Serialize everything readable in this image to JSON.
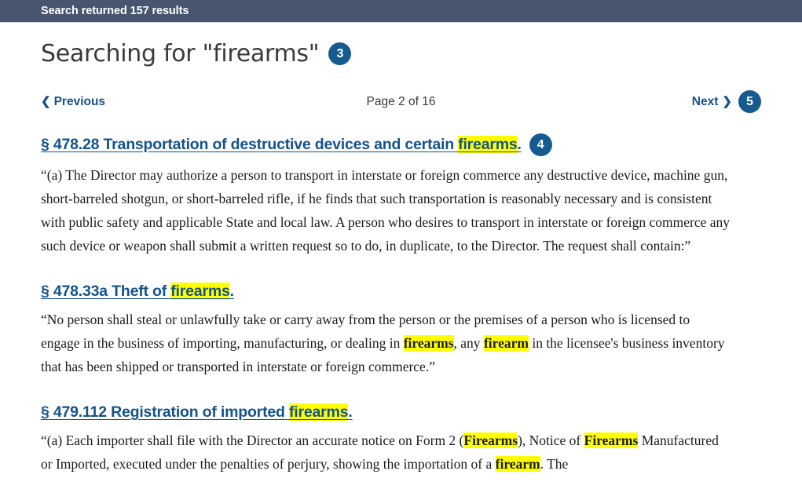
{
  "topbar": {
    "status_text": "Search returned 157 results"
  },
  "heading": {
    "prefix": "Searching for ",
    "query": "\"firearms\"",
    "badge": "3"
  },
  "pager": {
    "previous_label": "Previous",
    "previous_chevron": "❮",
    "next_label": "Next",
    "next_chevron": "❯",
    "next_badge": "5",
    "status": "Page 2 of 16",
    "current_page": 2,
    "total_pages": 16
  },
  "results": [
    {
      "title_before": "§ 478.28 Transportation of destructive devices and certain ",
      "title_highlight": "firearms",
      "title_after": ".",
      "badge": "4",
      "body_parts": [
        {
          "text": "“(a) The Director may authorize a person to transport in interstate or foreign commerce any destructive device, machine gun, short-barreled shotgun, or short-barreled rifle, if he finds that such transportation is reasonably necessary and is consistent with public safety and applicable State and local law. A person who desires to transport in interstate or foreign commerce any such device or weapon shall submit a written request so to do, in duplicate, to the Director. The request shall contain:”",
          "highlight": false
        }
      ]
    },
    {
      "title_before": "§ 478.33a Theft of ",
      "title_highlight": "firearms",
      "title_after": ".",
      "badge": "",
      "body_parts": [
        {
          "text": "“No person shall steal or unlawfully take or carry away from the person or the premises of a person who is licensed to engage in the business of importing, manufacturing, or dealing in ",
          "highlight": false
        },
        {
          "text": "firearms",
          "highlight": true
        },
        {
          "text": ", any ",
          "highlight": false
        },
        {
          "text": "firearm",
          "highlight": true
        },
        {
          "text": " in the licensee's business inventory that has been shipped or transported in interstate or foreign commerce.”",
          "highlight": false
        }
      ]
    },
    {
      "title_before": "§ 479.112 Registration of imported ",
      "title_highlight": "firearms",
      "title_after": ".",
      "badge": "",
      "body_parts": [
        {
          "text": "“(a) Each importer shall file with the Director an accurate notice on Form 2 (",
          "highlight": false
        },
        {
          "text": "Firearms",
          "highlight": true
        },
        {
          "text": "), Notice of ",
          "highlight": false
        },
        {
          "text": "Firearms",
          "highlight": true
        },
        {
          "text": " Manufactured or Imported, executed under the penalties of perjury, showing the importation of a ",
          "highlight": false
        },
        {
          "text": "firearm",
          "highlight": true
        },
        {
          "text": ". The",
          "highlight": false
        }
      ]
    }
  ],
  "colors": {
    "topbar_bg": "#47566e",
    "link_blue": "#14538c",
    "badge_blue": "#165b8f",
    "highlight_yellow": "#ffff00",
    "page_bg": "#ffffff"
  }
}
